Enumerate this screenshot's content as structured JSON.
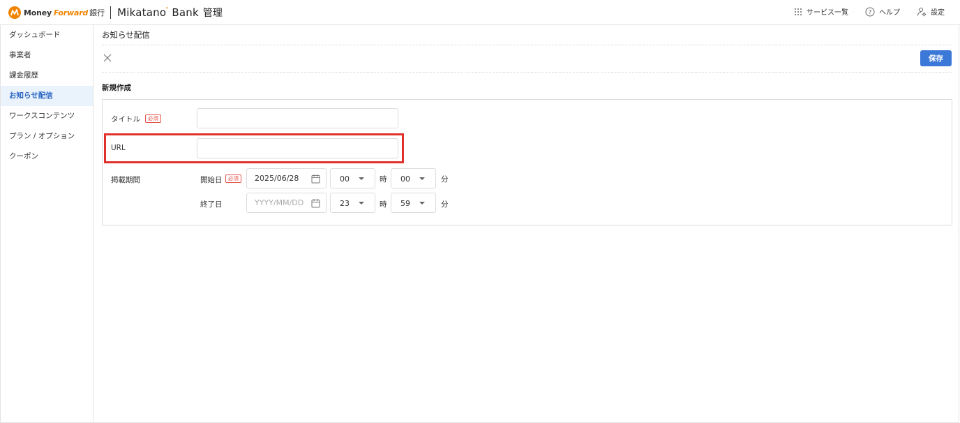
{
  "header": {
    "logo_money": "Money",
    "logo_forward": "Forward",
    "logo_bank": "銀行",
    "app_name": "Mikatano",
    "app_name_mark": "°",
    "app_name_2": "Bank",
    "app_suffix": "管理",
    "nav": {
      "services": "サービス一覧",
      "help": "ヘルプ",
      "settings": "設定"
    }
  },
  "sidebar": {
    "items": [
      {
        "label": "ダッシュボード",
        "active": false
      },
      {
        "label": "事業者",
        "active": false
      },
      {
        "label": "課金履歴",
        "active": false
      },
      {
        "label": "お知らせ配信",
        "active": true
      },
      {
        "label": "ワークスコンテンツ",
        "active": false
      },
      {
        "label": "プラン / オプション",
        "active": false
      },
      {
        "label": "クーポン",
        "active": false
      }
    ]
  },
  "main": {
    "page_title": "お知らせ配信",
    "save_label": "保存",
    "section_title": "新規作成",
    "form": {
      "title_label": "タイトル",
      "required_label": "必須",
      "title_value": "",
      "url_label": "URL",
      "url_value": "",
      "period_label": "掲載期間",
      "start_label": "開始日",
      "start_date": "2025/06/28",
      "start_hour": "00",
      "start_minute": "00",
      "end_label": "終了日",
      "end_date_placeholder": "YYYY/MM/DD",
      "end_hour": "23",
      "end_minute": "59",
      "hour_unit": "時",
      "minute_unit": "分"
    }
  },
  "colors": {
    "brand_orange": "#f08300",
    "primary_blue": "#3b78d8",
    "active_bg": "#eaf2fb",
    "required_red": "#e5534b",
    "highlight_red": "#e0322a"
  }
}
